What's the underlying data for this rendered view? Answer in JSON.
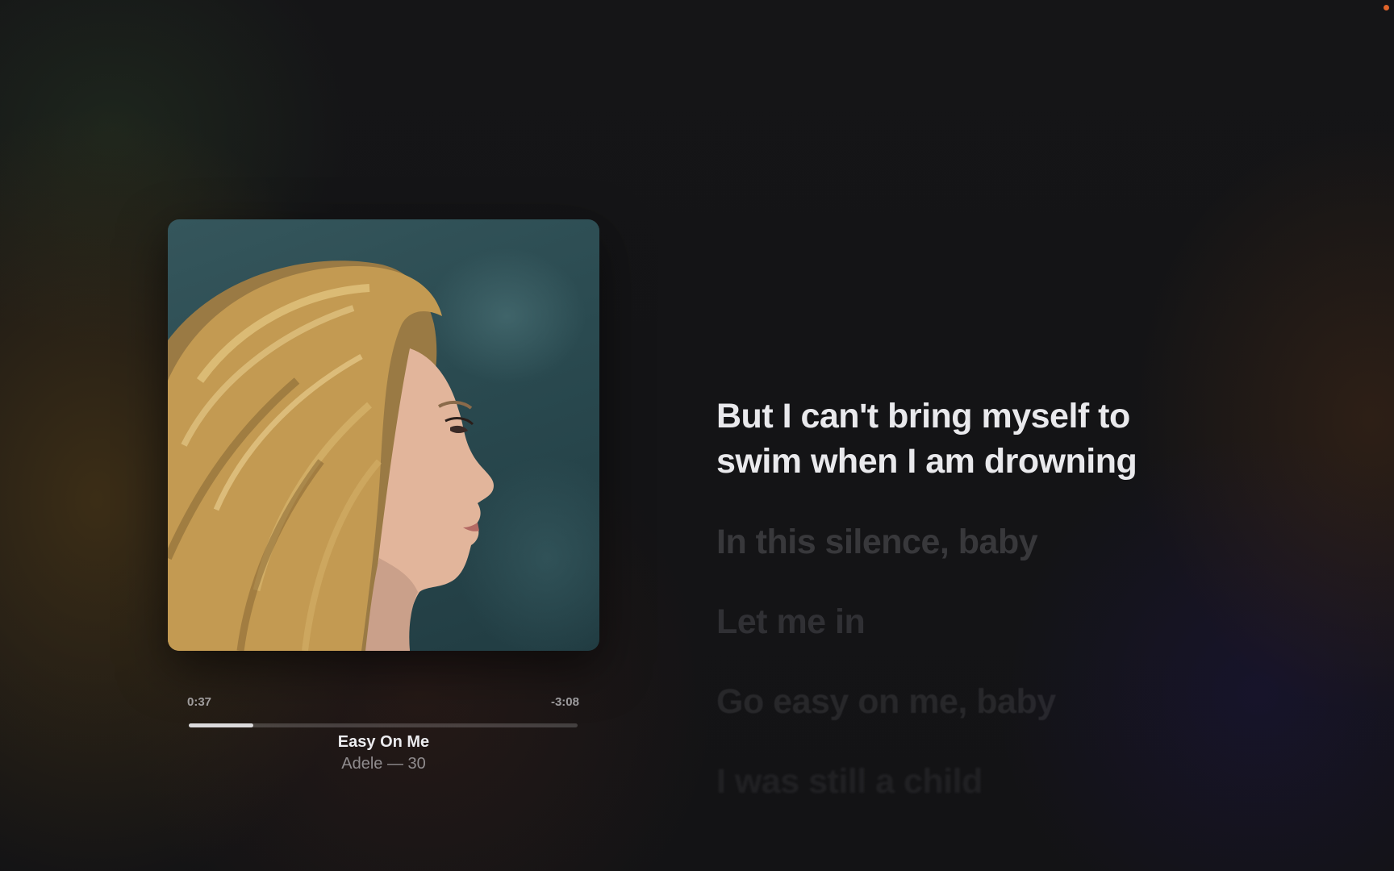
{
  "player": {
    "elapsed": "0:37",
    "remaining": "-3:08",
    "progress_fraction": 0.165,
    "track_title": "Easy On Me",
    "track_subtitle": "Adele — 30"
  },
  "artwork": {
    "icon": "album-artwork",
    "colors": {
      "background": "#2a4a50",
      "hair": "#c9a25a",
      "skin": "#e6b9a0"
    }
  },
  "lyrics": {
    "current": [
      "But I can't bring myself to",
      "swim when I am drowning"
    ],
    "upcoming": [
      "In this silence, baby",
      "Let me in",
      "Go easy on me, baby",
      "I was still a child"
    ]
  },
  "status": {
    "indicator_color": "#e0642a"
  }
}
